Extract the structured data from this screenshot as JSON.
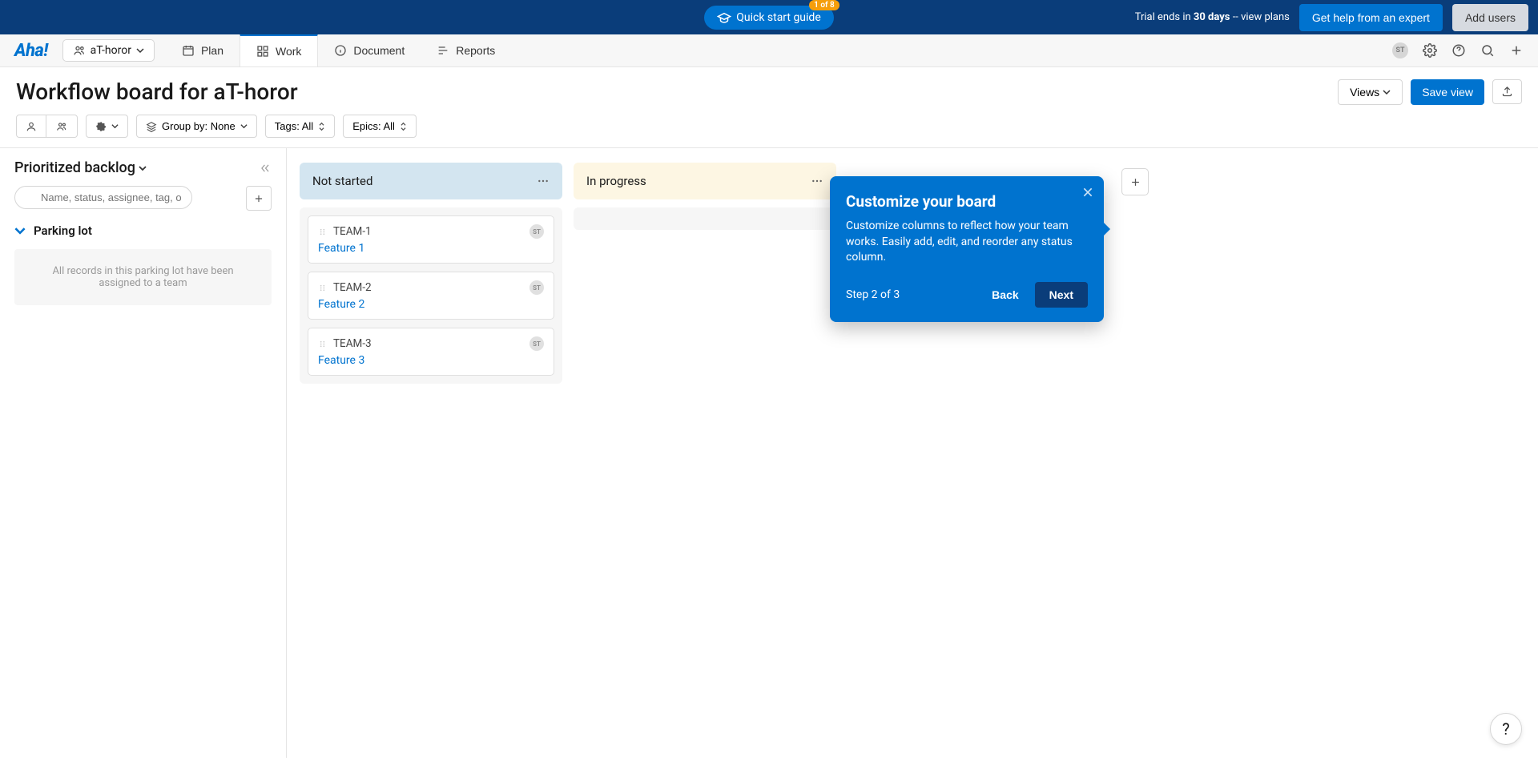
{
  "topbar": {
    "quickstart_label": "Quick start guide",
    "quickstart_badge": "1 of 8",
    "trial_prefix": "Trial ends in ",
    "trial_days": "30 days",
    "trial_suffix": " -- view plans",
    "expert_label": "Get help from an expert",
    "addusers_label": "Add users"
  },
  "navbar": {
    "logo": "Aha!",
    "team_name": "aT-horor",
    "tabs": {
      "plan": "Plan",
      "work": "Work",
      "document": "Document",
      "reports": "Reports"
    },
    "avatar_initials": "ST"
  },
  "page": {
    "title": "Workflow board for aT-horor",
    "views_label": "Views",
    "save_view_label": "Save view"
  },
  "toolbar": {
    "group_by": "Group by: None",
    "tags": "Tags: All",
    "epics": "Epics: All"
  },
  "sidebar": {
    "title": "Prioritized backlog",
    "search_placeholder": "Name, status, assignee, tag, or refe...",
    "parking_lot": "Parking lot",
    "parking_empty": "All records in this parking lot have been assigned to a team"
  },
  "board": {
    "col_not_started": "Not started",
    "col_in_progress": "In progress",
    "cards": [
      {
        "team": "TEAM-1",
        "feature": "Feature 1",
        "avatar": "ST"
      },
      {
        "team": "TEAM-2",
        "feature": "Feature 2",
        "avatar": "ST"
      },
      {
        "team": "TEAM-3",
        "feature": "Feature 3",
        "avatar": "ST"
      }
    ]
  },
  "popover": {
    "title": "Customize your board",
    "body": "Customize columns to reflect how your team works. Easily add, edit, and reorder any status column.",
    "step": "Step 2 of 3",
    "back": "Back",
    "next": "Next"
  },
  "help": "?"
}
